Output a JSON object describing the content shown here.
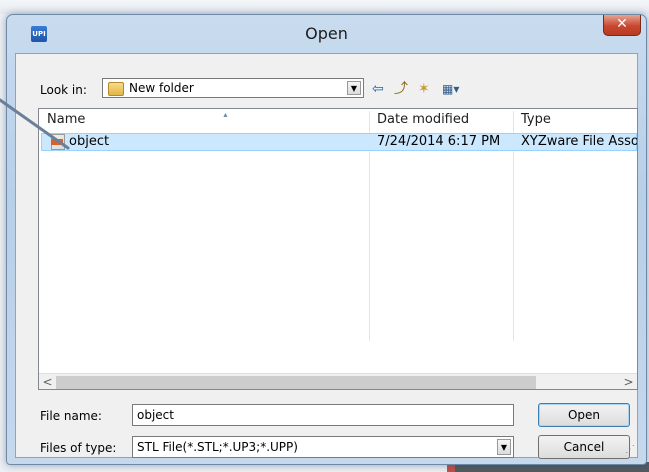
{
  "window": {
    "title": "Open",
    "app_icon_text": "UPI",
    "close_glyph": "✕"
  },
  "toolbar": {
    "look_in_label": "Look in:",
    "look_in_value": "New folder",
    "back_glyph": "⇦",
    "up_glyph": "⤴",
    "new_folder_glyph": "✶",
    "view_glyph": "▦▾"
  },
  "file_list": {
    "columns": [
      "Name",
      "Date modified",
      "Type"
    ],
    "rows": [
      {
        "name": "object",
        "date_modified": "7/24/2014 6:17 PM",
        "type": "XYZware File Asso..."
      }
    ],
    "scroll_left_glyph": "<",
    "scroll_right_glyph": ">"
  },
  "form": {
    "file_name_label": "File name:",
    "file_name_value": "object",
    "file_type_label": "Files of type:",
    "file_type_value": "STL File(*.STL;*.UP3;*.UPP)"
  },
  "buttons": {
    "open": "Open",
    "cancel": "Cancel"
  },
  "colors": {
    "selection": "#cce8ff",
    "close_button": "#c9472f"
  }
}
